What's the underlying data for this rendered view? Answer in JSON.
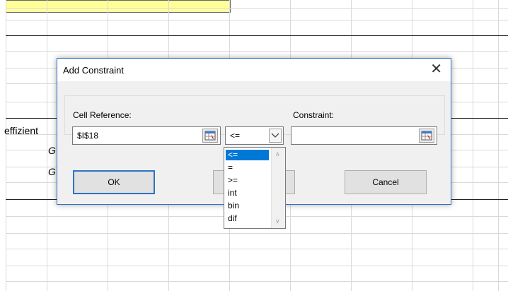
{
  "sheet": {
    "cell_text_1": "effizient",
    "cell_text_2": "G",
    "cell_text_3": "G"
  },
  "dialog": {
    "title": "Add Constraint",
    "close_glyph": "✕",
    "cell_reference_label": "Cell Reference:",
    "cell_reference_value": "$I$18",
    "operator_value": "<=",
    "constraint_label": "Constraint:",
    "constraint_value": "",
    "ok_label": "OK",
    "cancel_label": "Cancel",
    "add_label": ""
  },
  "dropdown": {
    "options": [
      "<=",
      "=",
      ">=",
      "int",
      "bin",
      "dif"
    ],
    "selected_index": 0
  },
  "icons": {
    "range_select": "range-selector-icon",
    "combo_arrow": "chevron-down-icon"
  },
  "colors": {
    "selection": "#0078d7",
    "dialog_border": "#2f72c4",
    "yellow_cell": "#ffff99"
  }
}
